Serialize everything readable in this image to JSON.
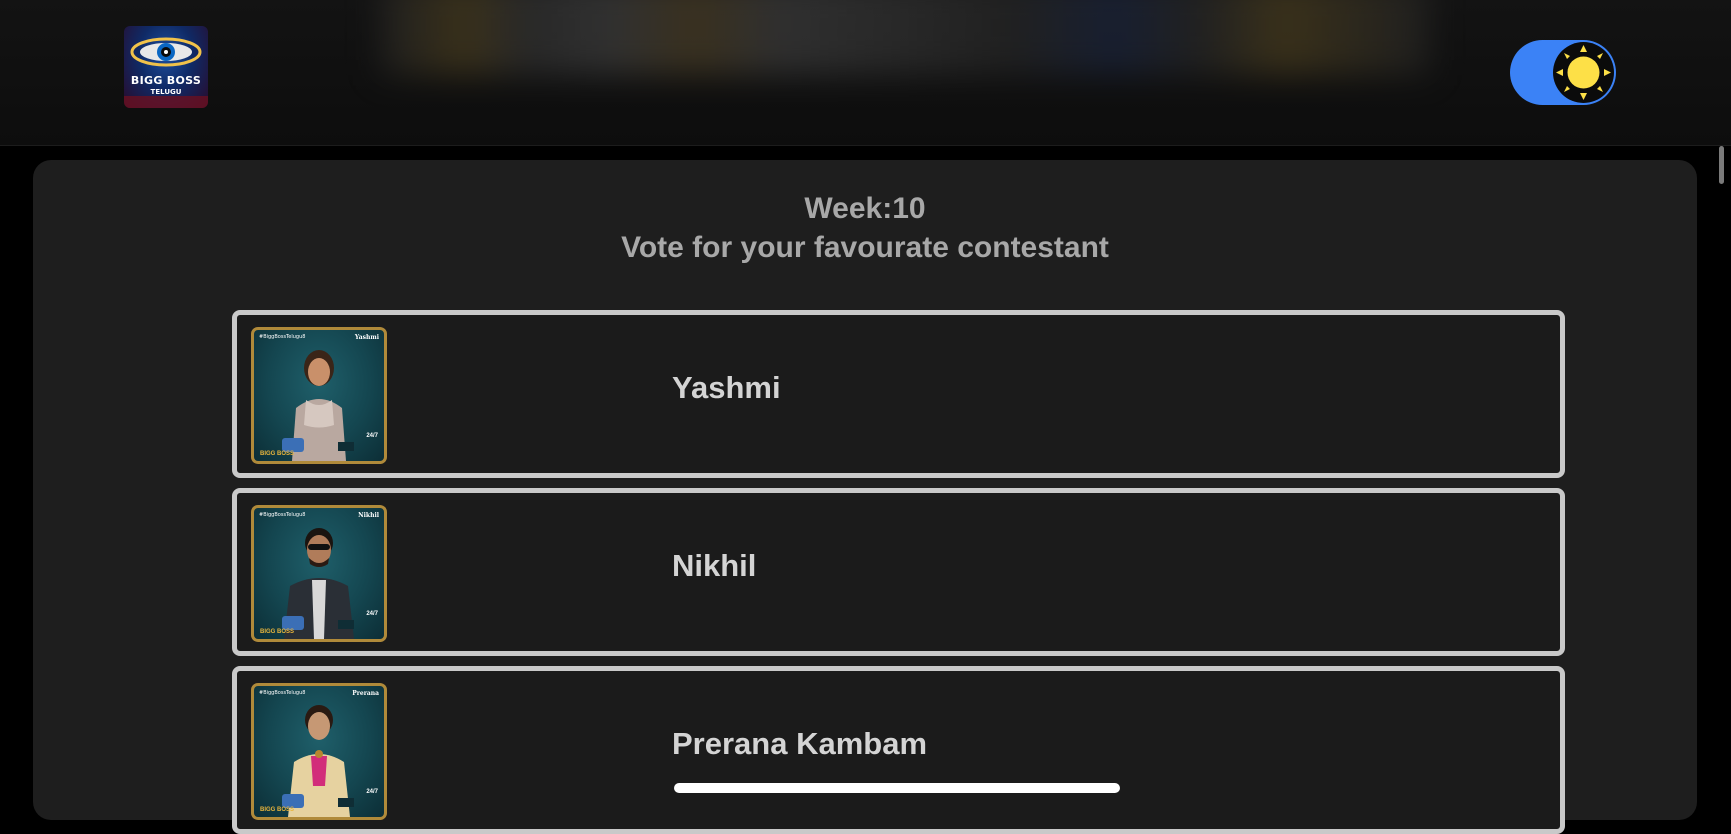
{
  "header": {
    "logo": {
      "title": "BIGG BOSS",
      "subtitle": "TELUGU",
      "icon": "eye-logo-icon"
    },
    "theme_toggle": {
      "state": "on",
      "icon": "sun-icon",
      "track_color": "#3b82f6",
      "sun_color": "#fde047"
    }
  },
  "main": {
    "week_label": "Week:10",
    "heading": "Vote for your favourate contestant"
  },
  "contestants": [
    {
      "name": "Yashmi",
      "photo_tag": "#BiggBossTelugu8",
      "photo_name": "Yashmi",
      "photo_badge": "24/7",
      "photo_brand": "BIGG BOSS"
    },
    {
      "name": "Nikhil",
      "photo_tag": "#BiggBossTelugu8",
      "photo_name": "Nikhil",
      "photo_badge": "24/7",
      "photo_brand": "BIGG BOSS"
    },
    {
      "name": "Prerana Kambam",
      "photo_tag": "#BiggBossTelugu8",
      "photo_name": "Prerana",
      "photo_badge": "24/7",
      "photo_brand": "BIGG BOSS"
    }
  ],
  "colors": {
    "background": "#000000",
    "panel": "#1e1e1e",
    "card_border": "#c9c9c9",
    "text_muted": "#a8a8a8",
    "text_name": "#d4d4d4",
    "accent": "#3b82f6"
  }
}
